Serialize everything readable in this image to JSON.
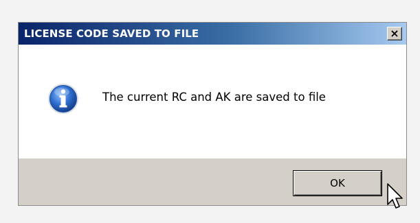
{
  "dialog": {
    "title": "LICENSE CODE SAVED TO FILE",
    "close_label": "×",
    "message": "The current RC and AK are saved to file",
    "icon": "info-icon",
    "ok_label": "OK"
  },
  "colors": {
    "titlebar_start": "#0a246a",
    "titlebar_end": "#a6caf0",
    "dialog_face": "#d4d0c8",
    "info_blue": "#2f6fd0"
  },
  "cursor": {
    "icon": "arrow-cursor"
  }
}
